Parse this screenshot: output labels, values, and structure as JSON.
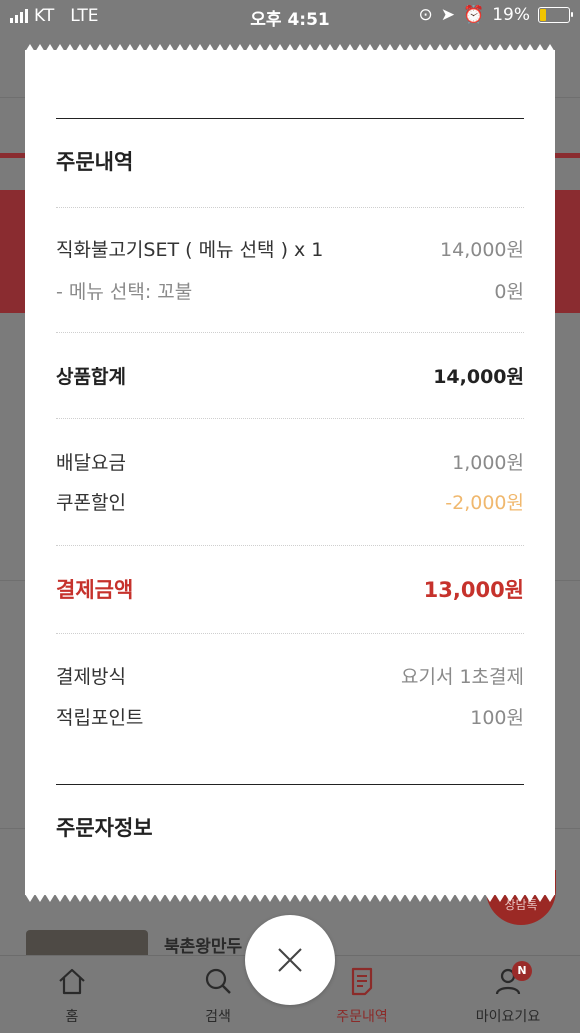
{
  "status_bar": {
    "carrier": "KT",
    "network": "LTE",
    "time": "오후 4:51",
    "battery": "19%"
  },
  "receipt": {
    "order_section_title": "주문내역",
    "item": {
      "name": "직화불고기SET ( 메뉴 선택 )  x 1",
      "price": "14,000원"
    },
    "option": {
      "name": "- 메뉴 선택: 꼬불",
      "price": "0원"
    },
    "subtotal": {
      "label": "상품합계",
      "value": "14,000원"
    },
    "delivery_fee": {
      "label": "배달요금",
      "value": "1,000원"
    },
    "coupon": {
      "label": "쿠폰할인",
      "value": "-2,000원"
    },
    "total": {
      "label": "결제금액",
      "value": "13,000원"
    },
    "payment_method": {
      "label": "결제방식",
      "value": "요기서 1초결제"
    },
    "points": {
      "label": "적립포인트",
      "value": "100원"
    },
    "customer_section_title": "주문자정보"
  },
  "background": {
    "peek_title": "북촌왕만두",
    "peek_badge": "상담톡"
  },
  "tabbar": {
    "tabs": [
      {
        "label": "홈",
        "icon": "home-icon"
      },
      {
        "label": "검색",
        "icon": "search-icon"
      },
      {
        "label": "주문내역",
        "icon": "order-list-icon"
      },
      {
        "label": "마이요기요",
        "icon": "profile-icon",
        "badge": "N"
      }
    ]
  },
  "colors": {
    "accent": "#c6322c",
    "discount": "#f0b86e"
  }
}
